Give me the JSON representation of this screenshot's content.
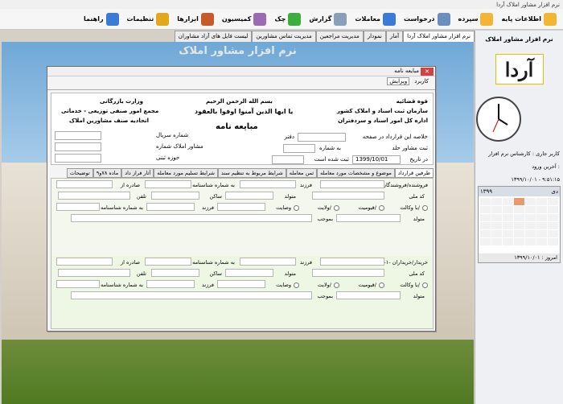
{
  "window_title": "نرم افزار مشاور املاک آردا",
  "menu": [
    {
      "label": "اطلاعات پایه",
      "icon": "folder-icon",
      "color": "#f2b632"
    },
    {
      "label": "سپرده",
      "icon": "folder-add-icon",
      "color": "#f2b632"
    },
    {
      "label": "درخواست",
      "icon": "edit-icon",
      "color": "#6a8fbf"
    },
    {
      "label": "معاملات",
      "icon": "pen-icon",
      "color": "#3a7bd5"
    },
    {
      "label": "گزارش",
      "icon": "magnifier-icon",
      "color": "#8aa0b8"
    },
    {
      "label": "چک",
      "icon": "check-icon",
      "color": "#3cae3c"
    },
    {
      "label": "کمیسیون",
      "icon": "book-icon",
      "color": "#9b6ab0"
    },
    {
      "label": "ابزارها",
      "icon": "tools-icon",
      "color": "#c85a2a"
    },
    {
      "label": "تنظیمات",
      "icon": "gear-icon",
      "color": "#e2a81c"
    },
    {
      "label": "راهنما",
      "icon": "help-icon",
      "color": "#3a7bd5"
    }
  ],
  "tabs": [
    "نرم افزار مشاور املاک آردا",
    "آمار",
    "نمودار",
    "مدیریت مراجعین",
    "مدیریت تماس مشاورین",
    "لیست فایل های آزاد مشاوران"
  ],
  "workspace_title": "نرم افزار مشاور املاک",
  "right_panel": {
    "title": "نرم افزار مشاور املاک",
    "logo_text": "آردا",
    "user_line": "کاربر جاری : کارشناس نرم افزار",
    "login_label": "آخرین ورود :",
    "login_value": "۱۳۹۹/۱۰/۰۱ - ۹:۵۱:۱۵",
    "month": "دی",
    "year": "۱۳۹۹",
    "today": "امروز : ۱۳۹۹/۱۰/۰۱"
  },
  "dialog": {
    "title": "مبایعه نامه",
    "menu": [
      "کاربرد",
      "ویرایش"
    ],
    "heading": "بسم الله الرحمن الرحیم",
    "subtitle": "مبایعه نامه",
    "verse": "یا ایها الذین آمنوا اوفوا بالعقود",
    "left_org": [
      "وزارت بازرگانی",
      "مجمع امور صنفی توزیعی - خدماتی",
      "اتحادیه صنف مشاورین املاک"
    ],
    "right_org": [
      "قوه قضائیه",
      "سازمان ثبت اسناد و املاک کشور",
      "اداره کل امور اسناد و سردفتران"
    ],
    "fields": {
      "summary": "خلاصه این قرارداد در صفحه",
      "office": "دفتر",
      "reg": "ثبت مشاور حلد",
      "number": "به شماره",
      "date_label": "در تاریخ",
      "date_value": "1399/10/01",
      "doc": "ثبت شده است",
      "serial": "شماره سریال",
      "advisor": "مشاور املاک شماره",
      "zone": "حوزه ثبتی"
    }
  },
  "form_tabs": [
    "طرفین قرارداد",
    "موضوع و مشخصات مورد معامله",
    "ثمن معامله",
    "شرایط مربوط به تنظیم سند",
    "شرایط تسلیم مورد معامله",
    "آثار فراز داد",
    "ماده ۷۸و۹",
    "توضیحات"
  ],
  "form": {
    "seller": "۱-۱- فروشنده/فروشندگان",
    "buyer": "۲-۱- خریدار/خریداران",
    "father": "فرزند",
    "id_no": "به شماره شناسنامه",
    "issued": "صادره از",
    "national": "کد ملی",
    "born": "متولد",
    "resident": "ساکن",
    "phone": "تلفن",
    "agency": "با وکالت/",
    "guardian": "قیومیت/",
    "custody": "ولایت/",
    "will": "وصایت",
    "dated": "بموجب"
  }
}
